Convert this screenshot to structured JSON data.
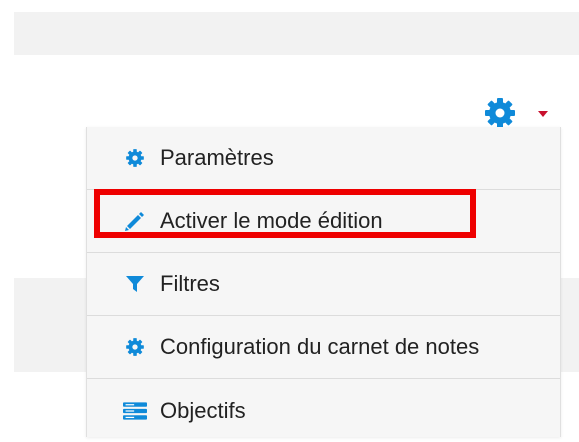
{
  "menu": {
    "items": [
      {
        "label": "Paramètres",
        "icon": "gear-icon"
      },
      {
        "label": "Activer le mode édition",
        "icon": "pencil-icon"
      },
      {
        "label": "Filtres",
        "icon": "filter-icon"
      },
      {
        "label": "Configuration du carnet de notes",
        "icon": "gear-icon"
      },
      {
        "label": "Objectifs",
        "icon": "server-icon"
      }
    ]
  },
  "colors": {
    "accent": "#0f8ad9",
    "caret": "#c8102e",
    "highlight": "#ee0000",
    "menu_bg": "#f6f6f6",
    "page_band": "#f2f2f2"
  }
}
